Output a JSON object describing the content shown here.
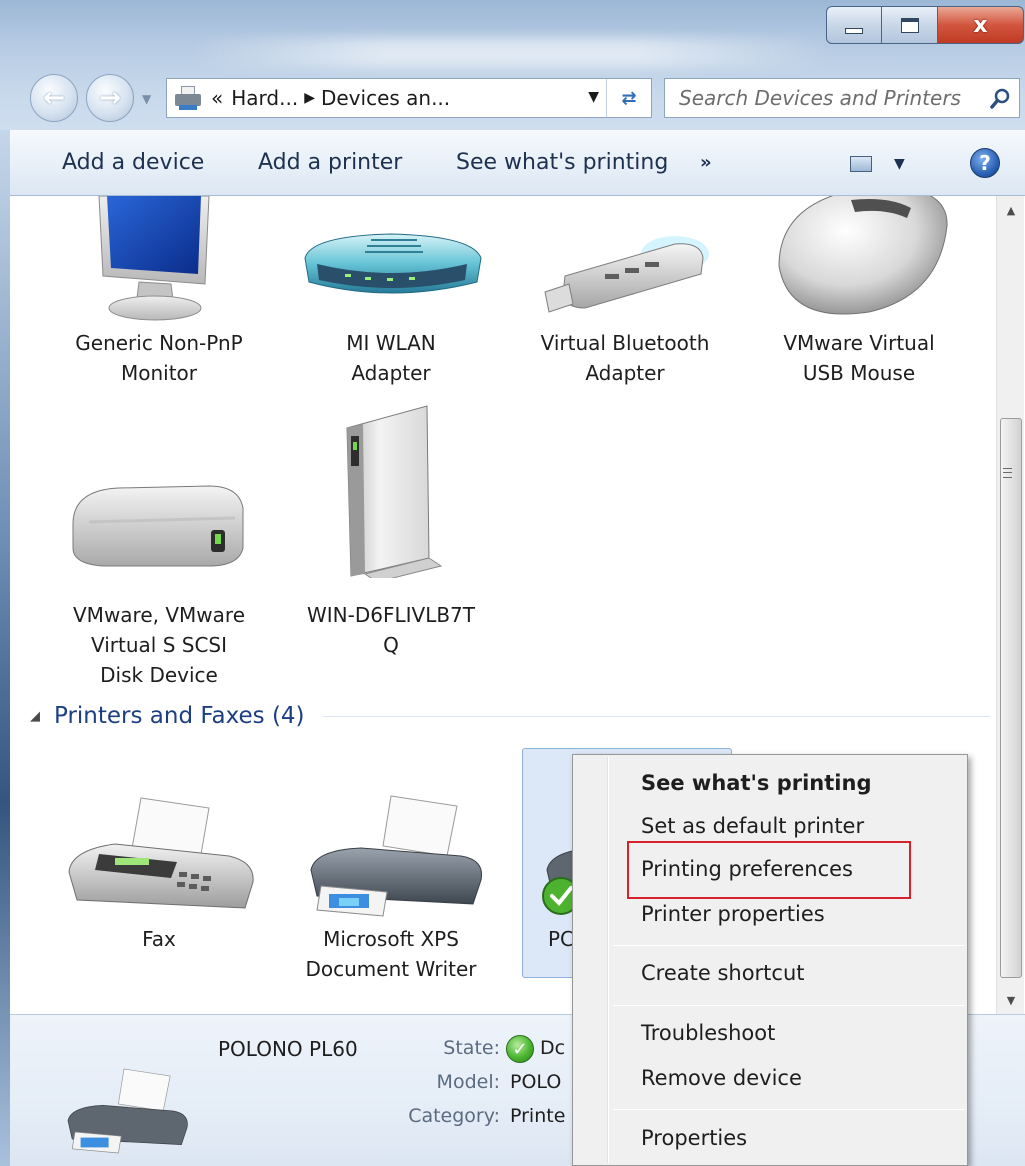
{
  "window": {
    "caption_close": "x"
  },
  "address_bar": {
    "overflow": "«",
    "crumbs": [
      "Hard...",
      "Devices an..."
    ],
    "search_placeholder": "Search Devices and Printers"
  },
  "toolbar": {
    "add_device": "Add a device",
    "add_printer": "Add a printer",
    "see_printing": "See what's printing",
    "more": "»"
  },
  "devices": [
    {
      "label_lines": [
        "Generic Non-PnP",
        "Monitor"
      ],
      "icon": "monitor-icon"
    },
    {
      "label_lines": [
        "MI WLAN",
        "Adapter"
      ],
      "icon": "router-icon"
    },
    {
      "label_lines": [
        "Virtual Bluetooth",
        "Adapter"
      ],
      "icon": "usb-dongle-icon"
    },
    {
      "label_lines": [
        "VMware Virtual",
        "USB Mouse"
      ],
      "icon": "mouse-icon"
    },
    {
      "label_lines": [
        "VMware, VMware",
        "Virtual S SCSI",
        "Disk Device"
      ],
      "icon": "hard-disk-icon"
    },
    {
      "label_lines": [
        "WIN-D6FLIVLB7T",
        "Q"
      ],
      "icon": "computer-tower-icon"
    }
  ],
  "printers_group": {
    "title": "Printers and Faxes (4)"
  },
  "printers": [
    {
      "label_lines": [
        "Fax"
      ],
      "icon": "fax-icon"
    },
    {
      "label_lines": [
        "Microsoft XPS",
        "Document Writer"
      ],
      "icon": "printer-icon"
    },
    {
      "label_lines": [
        "PC"
      ],
      "icon": "printer-default-icon",
      "selected": true
    }
  ],
  "details": {
    "name": "POLONO PL60",
    "state_label": "State:",
    "state_value": "Dc",
    "model_label": "Model:",
    "model_value": "POLO",
    "category_label": "Category:",
    "category_value": "Printe"
  },
  "context_menu": {
    "items": [
      {
        "label": "See what's printing",
        "bold": true
      },
      {
        "label": "Set as default printer"
      },
      {
        "label": "Printing preferences",
        "highlighted": true
      },
      {
        "label": "Printer properties"
      },
      {
        "label": "Create shortcut"
      },
      {
        "label": "Troubleshoot"
      },
      {
        "label": "Remove device"
      },
      {
        "label": "Properties"
      }
    ]
  },
  "colors": {
    "highlight_box": "#d8222b",
    "group_title": "#1c3f84",
    "selection_fill": "#dce8f7"
  }
}
